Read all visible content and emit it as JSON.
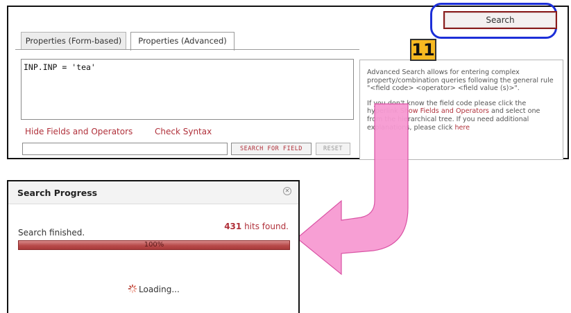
{
  "tabs": {
    "form_label": "Properties (Form-based)",
    "advanced_label": "Properties (Advanced)"
  },
  "query": {
    "value": "INP.INP = 'tea'"
  },
  "links": {
    "hide_fields": "Hide Fields and Operators",
    "check_syntax": "Check Syntax"
  },
  "field_search": {
    "value": "",
    "button_label": "SEARCH FOR FIELD",
    "reset_label": "RESET"
  },
  "search_button": {
    "label": "Search"
  },
  "step_badge": {
    "number": "11"
  },
  "help": {
    "paragraph1": "Advanced Search allows for entering complex property/combination queries following the general rule \"<field code> <operator> <field value (s)>\".",
    "p2_a": "If you don't know the field code please click the hyperlink ",
    "p2_link": "Show Fields and Operators",
    "p2_b": " and select one from the hierarchical tree. If you need additional explanations, please click ",
    "p2_here": "here"
  },
  "dialog": {
    "title": "Search Progress",
    "close_icon": "close-circle-icon",
    "status": "Search finished.",
    "hits_count": "431",
    "hits_suffix": " hits found.",
    "progress_percent": 100,
    "progress_label": "100%",
    "loading_text": "Loading...",
    "spinner_icon": "spinner-icon"
  },
  "colors": {
    "accent_red": "#b0303a",
    "highlight_blue": "#1c2fd8",
    "badge_orange": "#f7b921",
    "arrow_pink": "#f79ad2"
  }
}
